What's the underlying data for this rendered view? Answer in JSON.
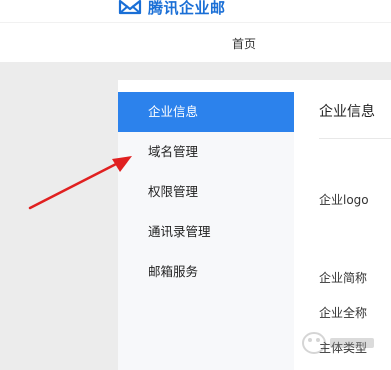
{
  "brand": {
    "name": "腾讯企业邮"
  },
  "nav": {
    "home_label": "首页"
  },
  "sidebar": {
    "items": [
      {
        "label": "企业信息",
        "active": true
      },
      {
        "label": "域名管理",
        "active": false
      },
      {
        "label": "权限管理",
        "active": false
      },
      {
        "label": "通讯录管理",
        "active": false
      },
      {
        "label": "邮箱服务",
        "active": false
      }
    ]
  },
  "main": {
    "title": "企业信息",
    "fields": {
      "logo": "企业logo",
      "short_name": "企业简称",
      "full_name": "企业全称",
      "entity_type": "主体类型"
    }
  },
  "colors": {
    "accent": "#2c82ec",
    "brand": "#1a6fd6",
    "annotation_arrow": "#e02020"
  }
}
